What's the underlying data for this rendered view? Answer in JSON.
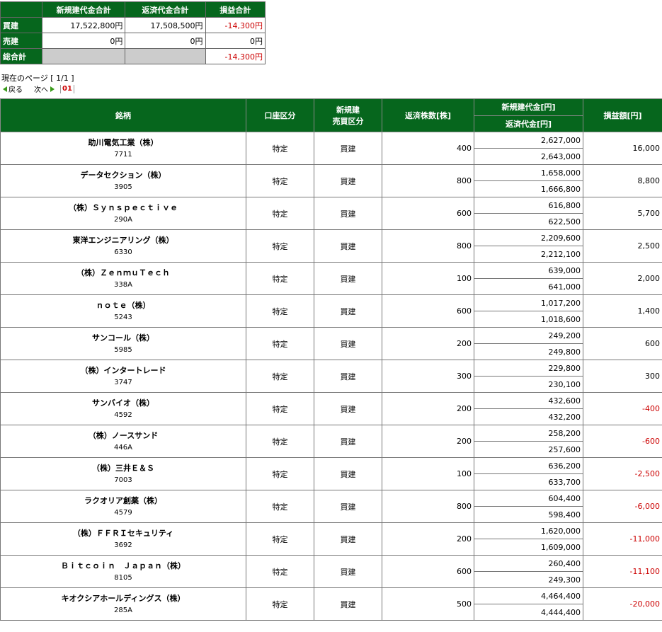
{
  "summary": {
    "headers": [
      "新規建代金合計",
      "返済代金合計",
      "損益合計"
    ],
    "rows": [
      {
        "label": "買建",
        "new": "17,522,800円",
        "settle": "17,508,500円",
        "pl": "-14,300円"
      },
      {
        "label": "売建",
        "new": "0円",
        "settle": "0円",
        "pl": "0円"
      },
      {
        "label": "総合計",
        "new": "",
        "settle": "",
        "pl": "-14,300円"
      }
    ]
  },
  "pager": {
    "page_info": "現在のページ [ 1/1 ]",
    "back": "戻る",
    "next": "次へ",
    "current": "01"
  },
  "table": {
    "headers": {
      "name": "銘柄",
      "account": "口座区分",
      "trade_line1": "新規建",
      "trade_line2": "売買区分",
      "qty": "返済株数[株]",
      "new_amount": "新規建代金[円]",
      "settle_amount": "返済代金[円]",
      "pl": "損益額[円]"
    },
    "rows": [
      {
        "name": "助川電気工業（株）",
        "code": "7711",
        "account": "特定",
        "type": "買建",
        "qty": "400",
        "new": "2,627,000",
        "settle": "2,643,000",
        "pl": "16,000",
        "neg": false
      },
      {
        "name": "データセクション（株）",
        "code": "3905",
        "account": "特定",
        "type": "買建",
        "qty": "800",
        "new": "1,658,000",
        "settle": "1,666,800",
        "pl": "8,800",
        "neg": false
      },
      {
        "name": "（株）Ｓｙｎｓｐｅｃｔｉｖｅ",
        "code": "290A",
        "account": "特定",
        "type": "買建",
        "qty": "600",
        "new": "616,800",
        "settle": "622,500",
        "pl": "5,700",
        "neg": false
      },
      {
        "name": "東洋エンジニアリング（株）",
        "code": "6330",
        "account": "特定",
        "type": "買建",
        "qty": "800",
        "new": "2,209,600",
        "settle": "2,212,100",
        "pl": "2,500",
        "neg": false
      },
      {
        "name": "（株）ＺｅｎｍｕＴｅｃｈ",
        "code": "338A",
        "account": "特定",
        "type": "買建",
        "qty": "100",
        "new": "639,000",
        "settle": "641,000",
        "pl": "2,000",
        "neg": false
      },
      {
        "name": "ｎｏｔｅ（株）",
        "code": "5243",
        "account": "特定",
        "type": "買建",
        "qty": "600",
        "new": "1,017,200",
        "settle": "1,018,600",
        "pl": "1,400",
        "neg": false
      },
      {
        "name": "サンコール（株）",
        "code": "5985",
        "account": "特定",
        "type": "買建",
        "qty": "200",
        "new": "249,200",
        "settle": "249,800",
        "pl": "600",
        "neg": false
      },
      {
        "name": "（株）インタートレード",
        "code": "3747",
        "account": "特定",
        "type": "買建",
        "qty": "300",
        "new": "229,800",
        "settle": "230,100",
        "pl": "300",
        "neg": false
      },
      {
        "name": "サンバイオ（株）",
        "code": "4592",
        "account": "特定",
        "type": "買建",
        "qty": "200",
        "new": "432,600",
        "settle": "432,200",
        "pl": "-400",
        "neg": true
      },
      {
        "name": "（株）ノースサンド",
        "code": "446A",
        "account": "特定",
        "type": "買建",
        "qty": "200",
        "new": "258,200",
        "settle": "257,600",
        "pl": "-600",
        "neg": true
      },
      {
        "name": "（株）三井Ｅ＆Ｓ",
        "code": "7003",
        "account": "特定",
        "type": "買建",
        "qty": "100",
        "new": "636,200",
        "settle": "633,700",
        "pl": "-2,500",
        "neg": true
      },
      {
        "name": "ラクオリア創薬（株）",
        "code": "4579",
        "account": "特定",
        "type": "買建",
        "qty": "800",
        "new": "604,400",
        "settle": "598,400",
        "pl": "-6,000",
        "neg": true
      },
      {
        "name": "（株）ＦＦＲＩセキュリティ",
        "code": "3692",
        "account": "特定",
        "type": "買建",
        "qty": "200",
        "new": "1,620,000",
        "settle": "1,609,000",
        "pl": "-11,000",
        "neg": true
      },
      {
        "name": "Ｂｉｔｃｏｉｎ　Ｊａｐａｎ（株）",
        "code": "8105",
        "account": "特定",
        "type": "買建",
        "qty": "600",
        "new": "260,400",
        "settle": "249,300",
        "pl": "-11,100",
        "neg": true
      },
      {
        "name": "キオクシアホールディングス（株）",
        "code": "285A",
        "account": "特定",
        "type": "買建",
        "qty": "500",
        "new": "4,464,400",
        "settle": "4,444,400",
        "pl": "-20,000",
        "neg": true
      }
    ]
  },
  "colors": {
    "header_green": "#06661d",
    "negative_red": "#cc0000",
    "gray_cell": "#cccccc"
  }
}
